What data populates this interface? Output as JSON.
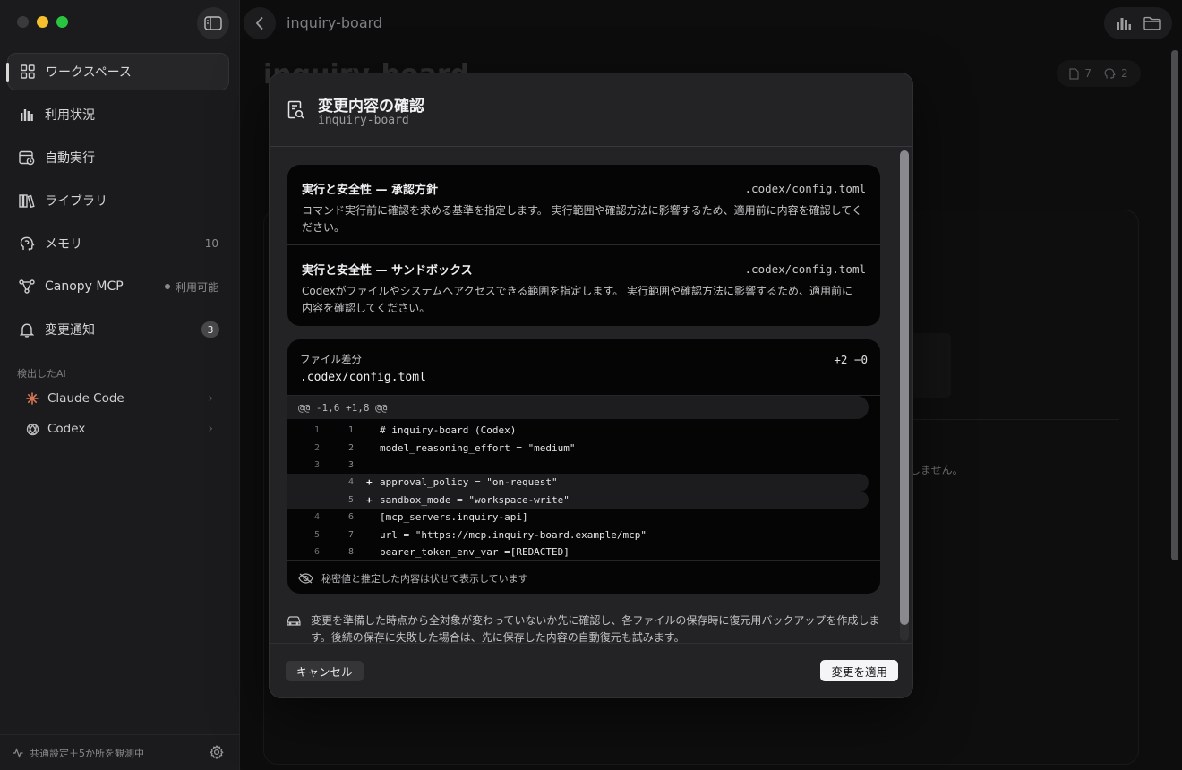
{
  "app": {
    "window_title": "inquiry-board"
  },
  "sidebar": {
    "items": [
      {
        "label": "ワークスペース",
        "icon": "grid-icon",
        "meta": ""
      },
      {
        "label": "利用状況",
        "icon": "bar-chart-icon",
        "meta": ""
      },
      {
        "label": "自動実行",
        "icon": "calendar-clock-icon",
        "meta": ""
      },
      {
        "label": "ライブラリ",
        "icon": "books-icon",
        "meta": ""
      },
      {
        "label": "メモリ",
        "icon": "head-icon",
        "meta": "10"
      },
      {
        "label": "Canopy MCP",
        "icon": "mcp-nodes-icon",
        "meta": "利用可能"
      },
      {
        "label": "変更通知",
        "icon": "bell-icon",
        "meta": "3"
      }
    ],
    "detected_section": "検出したAI",
    "detected_ai": [
      {
        "label": "Claude Code",
        "icon": "claude-sparkle-icon"
      },
      {
        "label": "Codex",
        "icon": "codex-knot-icon"
      }
    ],
    "footer_text": "共通設定＋5か所を観測中"
  },
  "main": {
    "project_title": "inquiry-board",
    "stats": {
      "files": "7",
      "memories": "2"
    },
    "background_text": "しません。"
  },
  "dialog": {
    "title": "変更内容の確認",
    "subtitle": "inquiry-board",
    "policies": [
      {
        "title": "実行と安全性 — 承認方針",
        "file": ".codex/config.toml",
        "description": "コマンド実行前に確認を求める基準を指定します。 実行範囲や確認方法に影響するため、適用前に内容を確認してください。"
      },
      {
        "title": "実行と安全性 — サンドボックス",
        "file": ".codex/config.toml",
        "description": "Codexがファイルやシステムへアクセスできる範囲を指定します。 実行範囲や確認方法に影響するため、適用前に内容を確認してください。"
      }
    ],
    "diff": {
      "label": "ファイル差分",
      "file": ".codex/config.toml",
      "stats": "+2  −0",
      "hunk_header": "@@ -1,6 +1,8 @@",
      "lines": [
        {
          "old": "1",
          "new": "1",
          "sign": "",
          "code": "# inquiry-board (Codex)",
          "type": "ctx"
        },
        {
          "old": "2",
          "new": "2",
          "sign": "",
          "code": "model_reasoning_effort = \"medium\"",
          "type": "ctx"
        },
        {
          "old": "3",
          "new": "3",
          "sign": "",
          "code": "",
          "type": "ctx"
        },
        {
          "old": "",
          "new": "4",
          "sign": "+",
          "code": "approval_policy = \"on-request\"",
          "type": "add"
        },
        {
          "old": "",
          "new": "5",
          "sign": "+",
          "code": "sandbox_mode = \"workspace-write\"",
          "type": "add"
        },
        {
          "old": "4",
          "new": "6",
          "sign": "",
          "code": "[mcp_servers.inquiry-api]",
          "type": "ctx"
        },
        {
          "old": "5",
          "new": "7",
          "sign": "",
          "code": "url = \"https://mcp.inquiry-board.example/mcp\"",
          "type": "ctx"
        },
        {
          "old": "6",
          "new": "8",
          "sign": "",
          "code": "bearer_token_env_var =[REDACTED]",
          "type": "ctx"
        }
      ],
      "redaction_note": "秘密値と推定した内容は伏せて表示しています"
    },
    "note": "変更を準備した時点から全対象が変わっていないか先に確認し、各ファイルの保存時に復元用バックアップを作成します。後続の保存に失敗した場合は、先に保存した内容の自動復元も試みます。",
    "cancel_label": "キャンセル",
    "apply_label": "変更を適用"
  }
}
